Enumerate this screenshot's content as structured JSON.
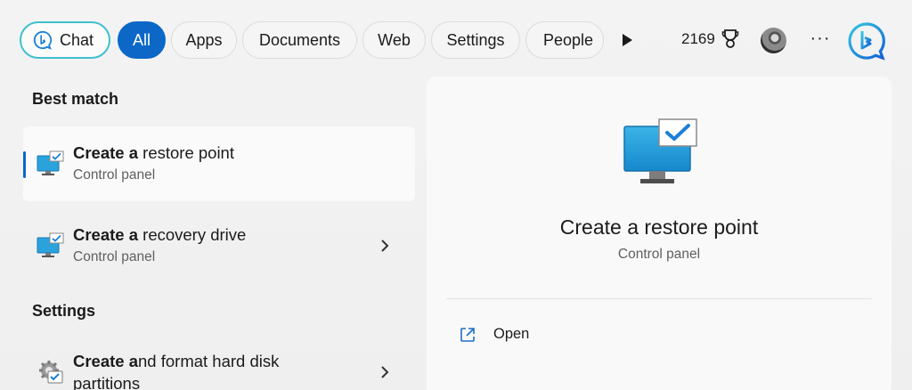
{
  "filters": {
    "chat": "Chat",
    "all": "All",
    "apps": "Apps",
    "documents": "Documents",
    "web": "Web",
    "settings": "Settings",
    "people": "People",
    "active": "All"
  },
  "rewards": {
    "points": "2169"
  },
  "sections": {
    "best_match": "Best match",
    "settings": "Settings"
  },
  "results": [
    {
      "title_bold": "Create a",
      "title_rest": " restore point",
      "subtitle": "Control panel",
      "selected": true
    },
    {
      "title_bold": "Create a",
      "title_rest": " recovery drive",
      "subtitle": "Control panel",
      "selected": false
    },
    {
      "title_bold": "Create a",
      "title_rest": "nd format hard disk",
      "title_line2": "partitions",
      "selected": false
    }
  ],
  "preview": {
    "title": "Create a restore point",
    "subtitle": "Control panel",
    "actions": [
      {
        "label": "Open"
      }
    ]
  },
  "colors": {
    "accent": "#0c67c7",
    "chat_border": "#3ec1cf",
    "background": "#f3f3f3"
  },
  "icons": [
    "bing-chat-icon",
    "play-icon",
    "trophy-icon",
    "avatar",
    "more-icon",
    "bing-logo-icon",
    "monitor-check-icon",
    "chevron-right-icon",
    "disk-management-icon",
    "open-external-icon"
  ]
}
